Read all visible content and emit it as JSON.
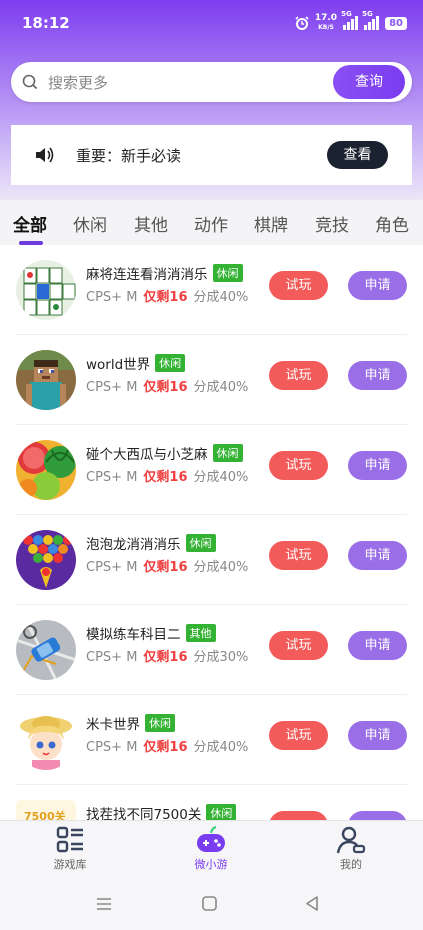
{
  "status_bar": {
    "time": "18:12",
    "net_speed": "17.0",
    "net_unit": "KB/S",
    "sim1": "5G",
    "sim2": "5G",
    "battery": "80"
  },
  "search": {
    "placeholder": "搜索更多",
    "button_label": "查询"
  },
  "notice": {
    "text": "重要：新手必读",
    "button_label": "查看"
  },
  "tabs": [
    {
      "label": "全部",
      "active": true
    },
    {
      "label": "休闲"
    },
    {
      "label": "其他"
    },
    {
      "label": "动作"
    },
    {
      "label": "棋牌"
    },
    {
      "label": "竞技"
    },
    {
      "label": "角色"
    }
  ],
  "games": [
    {
      "name": "麻将连连看消消消乐",
      "tag": "休闲",
      "cps": "CPS+ M",
      "left": "仅剩16",
      "share": "分成40%",
      "try": "试玩",
      "apply": "申请"
    },
    {
      "name": "world世界",
      "tag": "休闲",
      "cps": "CPS+ M",
      "left": "仅剩16",
      "share": "分成40%",
      "try": "试玩",
      "apply": "申请"
    },
    {
      "name": "碰个大西瓜与小芝麻",
      "tag": "休闲",
      "cps": "CPS+ M",
      "left": "仅剩16",
      "share": "分成40%",
      "try": "试玩",
      "apply": "申请"
    },
    {
      "name": "泡泡龙消消消乐",
      "tag": "休闲",
      "cps": "CPS+ M",
      "left": "仅剩16",
      "share": "分成40%",
      "try": "试玩",
      "apply": "申请"
    },
    {
      "name": "模拟练车科目二",
      "tag": "其他",
      "cps": "CPS+ M",
      "left": "仅剩16",
      "share": "分成30%",
      "try": "试玩",
      "apply": "申请"
    },
    {
      "name": "米卡世界",
      "tag": "休闲",
      "cps": "CPS+ M",
      "left": "仅剩16",
      "share": "分成40%",
      "try": "试玩",
      "apply": "申请"
    },
    {
      "name": "找茬找不同7500关",
      "tag": "休闲",
      "thumb_text": "7500关",
      "cps": "",
      "left": "",
      "share": "",
      "try": "",
      "apply": ""
    }
  ],
  "bottom_nav": [
    {
      "label": "游戏库",
      "icon": "list-icon"
    },
    {
      "label": "微小游",
      "icon": "gamepad-icon",
      "active": true
    },
    {
      "label": "我的",
      "icon": "user-icon"
    }
  ],
  "colors": {
    "accent": "#7a3cf0",
    "try": "#f35a5a",
    "apply": "#9a6ee6",
    "badge": "#34b233",
    "remaining": "#f04040"
  }
}
